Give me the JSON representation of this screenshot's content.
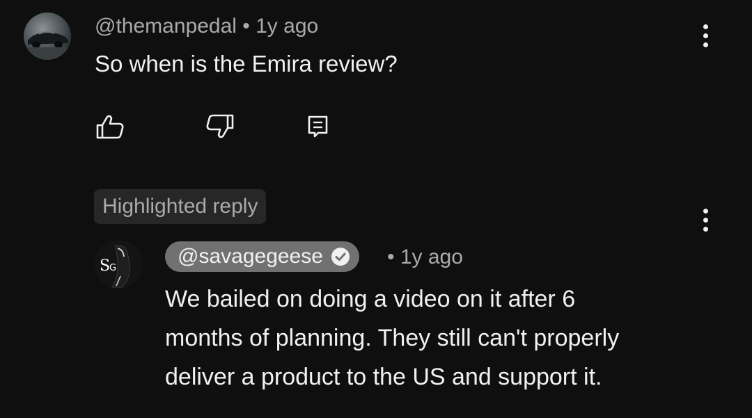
{
  "comment": {
    "author": "@themanpedal",
    "separator": " • ",
    "time": "1y ago",
    "text": "So when is the Emira review?",
    "actions": {
      "like_icon": "thumbs-up-icon",
      "dislike_icon": "thumbs-down-icon",
      "reply_icon": "reply-icon"
    },
    "more_icon": "more-vertical-icon"
  },
  "highlighted_reply": {
    "badge": "Highlighted reply",
    "author": "@savagegeese",
    "verified_icon": "verified-check-icon",
    "separator": "• ",
    "time": "1y ago",
    "avatar_letters": "SG",
    "text_lines": [
      "We bailed on doing a video on it after 6",
      "months of planning. They still can't properly",
      "deliver a product to the US and support it."
    ],
    "more_icon": "more-vertical-icon"
  },
  "colors": {
    "background": "#0f0f0f",
    "primary_text": "#f1f1f1",
    "secondary_text": "#aaaaaa",
    "badge_bg": "#272727",
    "author_chip_bg": "#717171"
  }
}
